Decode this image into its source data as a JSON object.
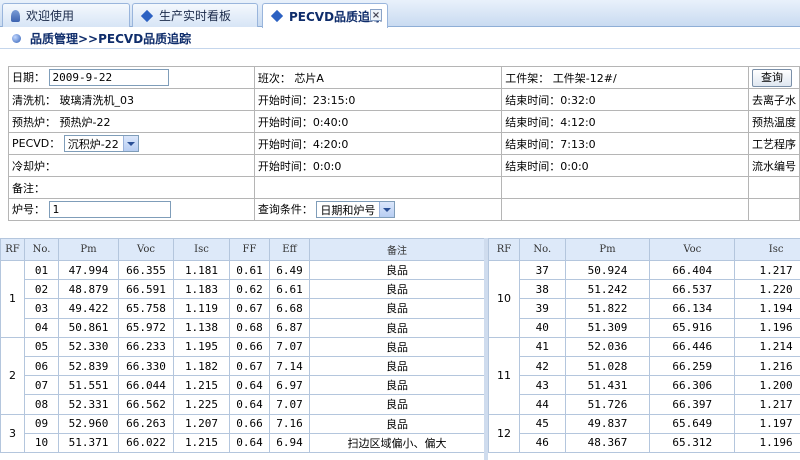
{
  "tabs": [
    {
      "label": "欢迎使用",
      "icon": "person-icon",
      "active": false
    },
    {
      "label": "生产实时看板",
      "icon": "diamond-icon",
      "active": false
    },
    {
      "label": "PECVD品质追踪",
      "icon": "diamond-icon",
      "active": true,
      "closable": true
    }
  ],
  "breadcrumb": "品质管理>>PECVD品质追踪",
  "form": {
    "date_label": "日期：",
    "date_value": "2009-9-22",
    "shift": "班次： 芯片A",
    "rack": "工件架： 工件架-12#/",
    "query_button": "查询",
    "cleaner": "清洗机： 玻璃清洗机_03",
    "cleaner_start": "开始时间：23:15:0",
    "cleaner_end": "结束时间：0:32:0",
    "cleaner_extra": "去离子水",
    "preheat": "预热炉： 预热炉-22",
    "preheat_start": "开始时间：0:40:0",
    "preheat_end": "结束时间：4:12:0",
    "preheat_extra": "预热温度",
    "pecvd_label": "PECVD：",
    "pecvd_select": "沉积炉-22",
    "pecvd_start": "开始时间：4:20:0",
    "pecvd_end": "结束时间：7:13:0",
    "pecvd_extra": "工艺程序",
    "cool": "冷却炉：",
    "cool_start": "开始时间：0:0:0",
    "cool_end": "结束时间：0:0:0",
    "cool_extra": "流水编号",
    "remark": "备注：",
    "furnace_label": "炉号：",
    "furnace_value": "1",
    "cond_label": "查询条件：",
    "cond_select": "日期和炉号"
  },
  "left_table": {
    "headers": [
      "RF",
      "No.",
      "Pm",
      "Voc",
      "Isc",
      "FF",
      "Eff",
      "备注"
    ],
    "groups": [
      {
        "rf": "1",
        "rows": [
          [
            "01",
            "47.994",
            "66.355",
            "1.181",
            "0.61",
            "6.49",
            "良品"
          ],
          [
            "02",
            "48.879",
            "66.591",
            "1.183",
            "0.62",
            "6.61",
            "良品"
          ],
          [
            "03",
            "49.422",
            "65.758",
            "1.119",
            "0.67",
            "6.68",
            "良品"
          ],
          [
            "04",
            "50.861",
            "65.972",
            "1.138",
            "0.68",
            "6.87",
            "良品"
          ]
        ]
      },
      {
        "rf": "2",
        "rows": [
          [
            "05",
            "52.330",
            "66.233",
            "1.195",
            "0.66",
            "7.07",
            "良品"
          ],
          [
            "06",
            "52.839",
            "66.330",
            "1.182",
            "0.67",
            "7.14",
            "良品"
          ],
          [
            "07",
            "51.551",
            "66.044",
            "1.215",
            "0.64",
            "6.97",
            "良品"
          ],
          [
            "08",
            "52.331",
            "66.562",
            "1.225",
            "0.64",
            "7.07",
            "良品"
          ]
        ]
      },
      {
        "rf": "3",
        "rows": [
          [
            "09",
            "52.960",
            "66.263",
            "1.207",
            "0.66",
            "7.16",
            "良品"
          ],
          [
            "10",
            "51.371",
            "66.022",
            "1.215",
            "0.64",
            "6.94",
            "扫边区域偏小、偏大"
          ]
        ]
      }
    ]
  },
  "right_table": {
    "headers": [
      "RF",
      "No.",
      "Pm",
      "Voc",
      "Isc"
    ],
    "groups": [
      {
        "rf": "10",
        "rows": [
          [
            "37",
            "50.924",
            "66.404",
            "1.217"
          ],
          [
            "38",
            "51.242",
            "66.537",
            "1.220"
          ],
          [
            "39",
            "51.822",
            "66.134",
            "1.194"
          ],
          [
            "40",
            "51.309",
            "65.916",
            "1.196"
          ]
        ]
      },
      {
        "rf": "11",
        "rows": [
          [
            "41",
            "52.036",
            "66.446",
            "1.214"
          ],
          [
            "42",
            "51.028",
            "66.259",
            "1.216"
          ],
          [
            "43",
            "51.431",
            "66.306",
            "1.200"
          ],
          [
            "44",
            "51.726",
            "66.397",
            "1.217"
          ]
        ]
      },
      {
        "rf": "12",
        "rows": [
          [
            "45",
            "49.837",
            "65.649",
            "1.197"
          ],
          [
            "46",
            "48.367",
            "65.312",
            "1.196"
          ]
        ]
      }
    ]
  }
}
